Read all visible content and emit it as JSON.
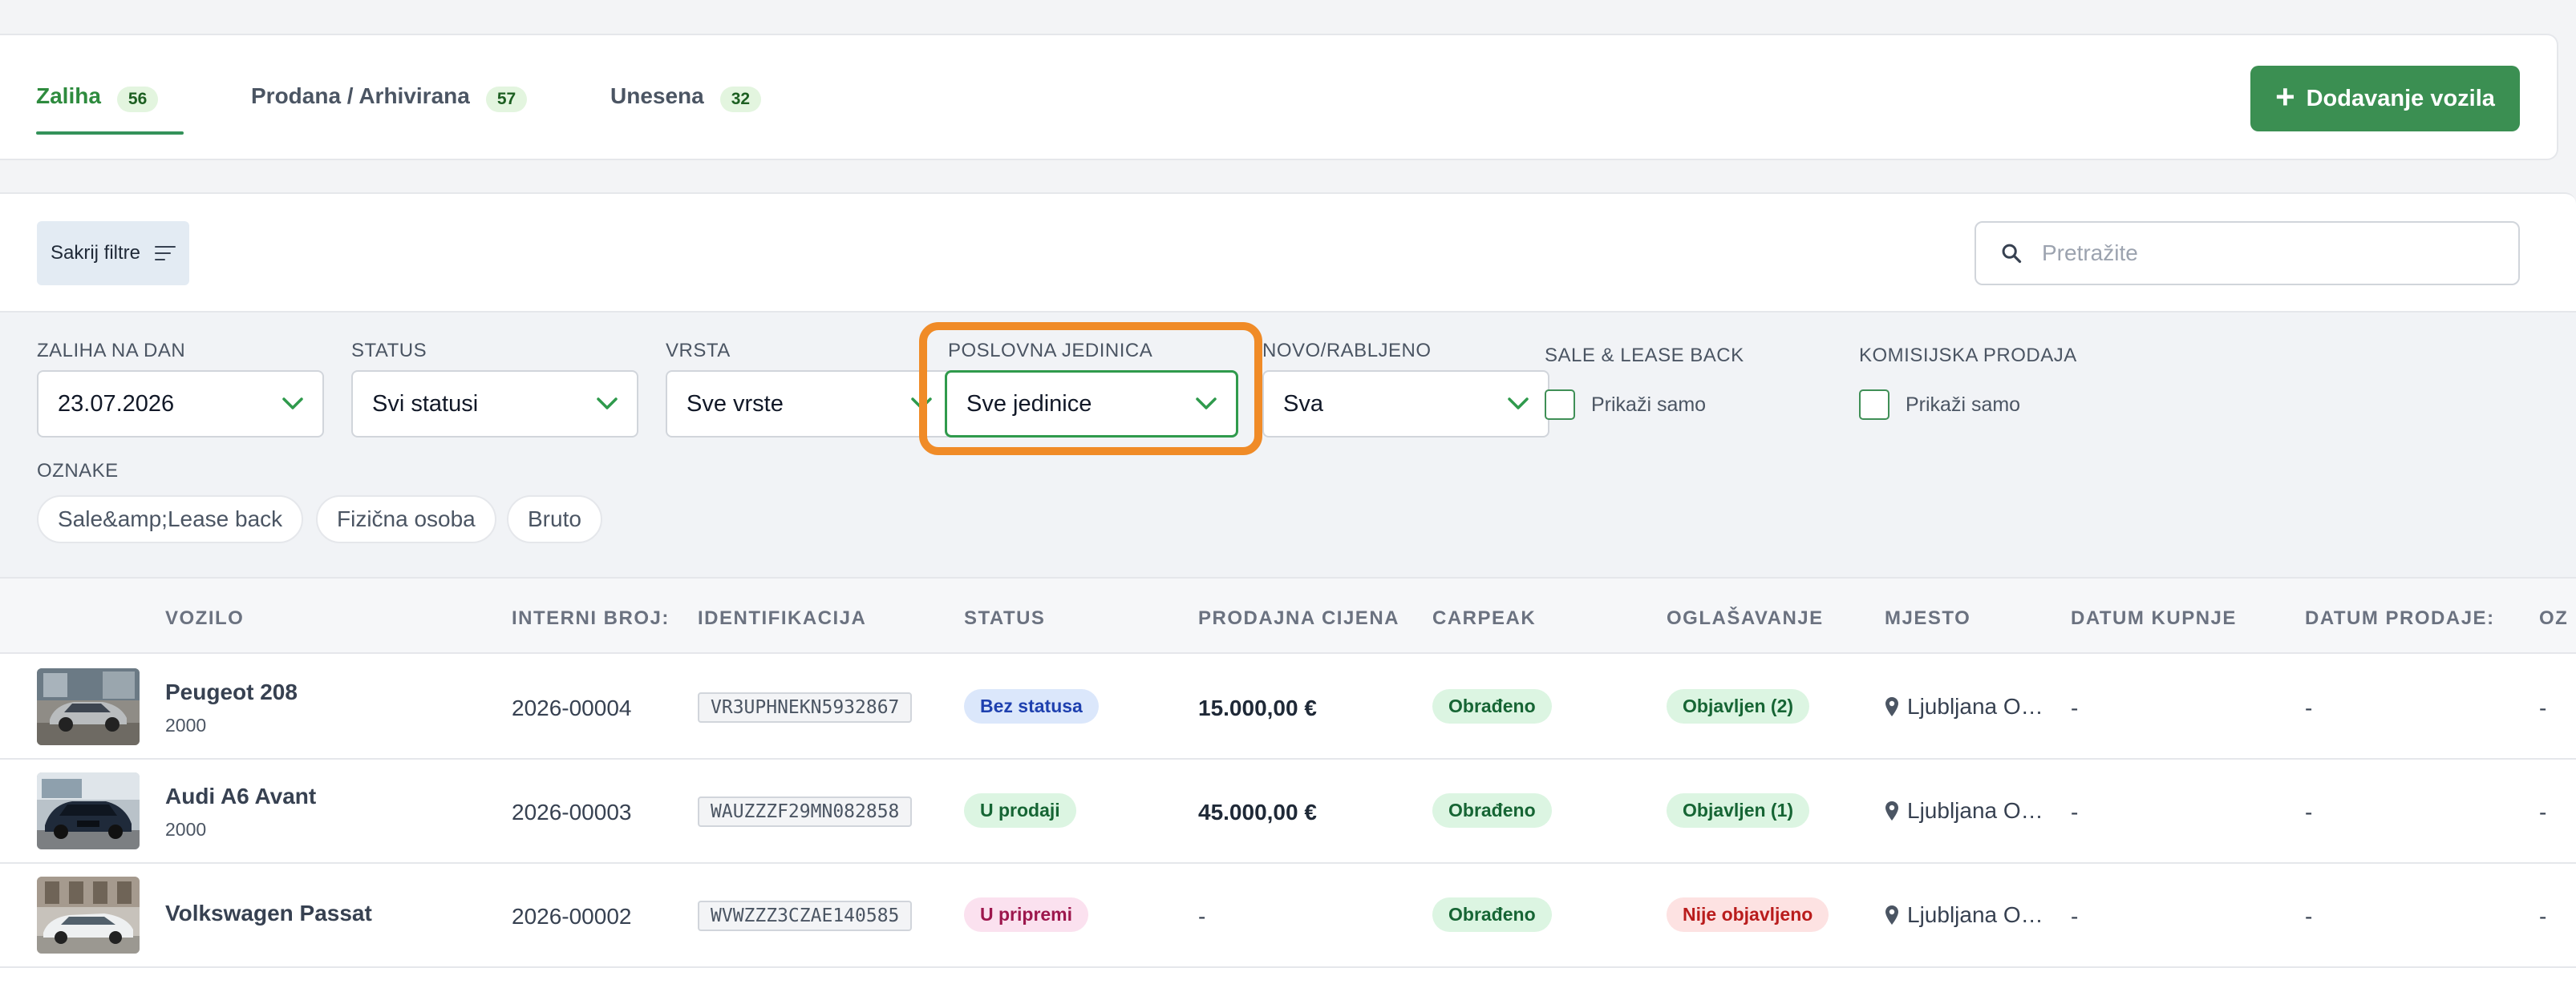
{
  "tabs": [
    {
      "label": "Zaliha",
      "count": "56"
    },
    {
      "label": "Prodana / Arhivirana",
      "count": "57"
    },
    {
      "label": "Unesena",
      "count": "32"
    }
  ],
  "add_button_label": "Dodavanje vozila",
  "hide_filters_label": "Sakrij filtre",
  "search": {
    "placeholder": "Pretražite",
    "value": ""
  },
  "filters": {
    "stock_date": {
      "label": "ZALIHA NA DAN",
      "value": "23.07.2026"
    },
    "status": {
      "label": "STATUS",
      "value": "Svi statusi"
    },
    "type": {
      "label": "VRSTA",
      "value": "Sve vrste"
    },
    "business_unit": {
      "label": "POSLOVNA JEDINICA",
      "value": "Sve jedinice"
    },
    "new_used": {
      "label": "NOVO/RABLJENO",
      "value": "Sva"
    },
    "sale_lease_back": {
      "label": "SALE & LEASE BACK",
      "checkbox_label": "Prikaži samo",
      "checked": false
    },
    "commission_sale": {
      "label": "KOMISIJSKA PRODAJA",
      "checkbox_label": "Prikaži samo",
      "checked": false
    },
    "tags": {
      "label": "OZNAKE",
      "items": [
        "Sale&amp;Lease back",
        "Fizična osoba",
        "Bruto"
      ]
    }
  },
  "table": {
    "headers": {
      "vehicle": "VOZILO",
      "internal": "INTERNI BROJ:",
      "identification": "IDENTIFIKACIJA",
      "status": "STATUS",
      "price": "PRODAJNA CIJENA",
      "carpeak": "CARPEAK",
      "ads": "OGLAŠAVANJE",
      "location": "MJESTO",
      "purchase_date": "DATUM KUPNJE",
      "sale_date": "DATUM PRODAJE:",
      "cut_off": "OZ"
    },
    "rows": [
      {
        "name": "Peugeot 208",
        "year": "2000",
        "internal": "2026-00004",
        "vin": "VR3UPHNEKN5932867",
        "status": "Bez statusa",
        "price": "15.000,00 €",
        "carpeak": "Obrađeno",
        "ads": "Objavljen (2)",
        "location": "Ljubljana O…",
        "purchase_date": "-",
        "sale_date": "-",
        "last": "-"
      },
      {
        "name": "Audi A6 Avant",
        "year": "2000",
        "internal": "2026-00003",
        "vin": "WAUZZZF29MN082858",
        "status": "U prodaji",
        "price": "45.000,00 €",
        "carpeak": "Obrađeno",
        "ads": "Objavljen (1)",
        "location": "Ljubljana O…",
        "purchase_date": "-",
        "sale_date": "-",
        "last": "-"
      },
      {
        "name": "Volkswagen Passat",
        "year": "",
        "internal": "2026-00002",
        "vin": "WVWZZZ3CZAE140585",
        "status": "U pripremi",
        "price": "-",
        "carpeak": "Obrađeno",
        "ads": "Nije objavljeno",
        "location": "Ljubljana O…",
        "purchase_date": "-",
        "sale_date": "-",
        "last": "-"
      }
    ]
  },
  "colors": {
    "accent": "#3b8f52",
    "highlight": "#f08b27"
  }
}
